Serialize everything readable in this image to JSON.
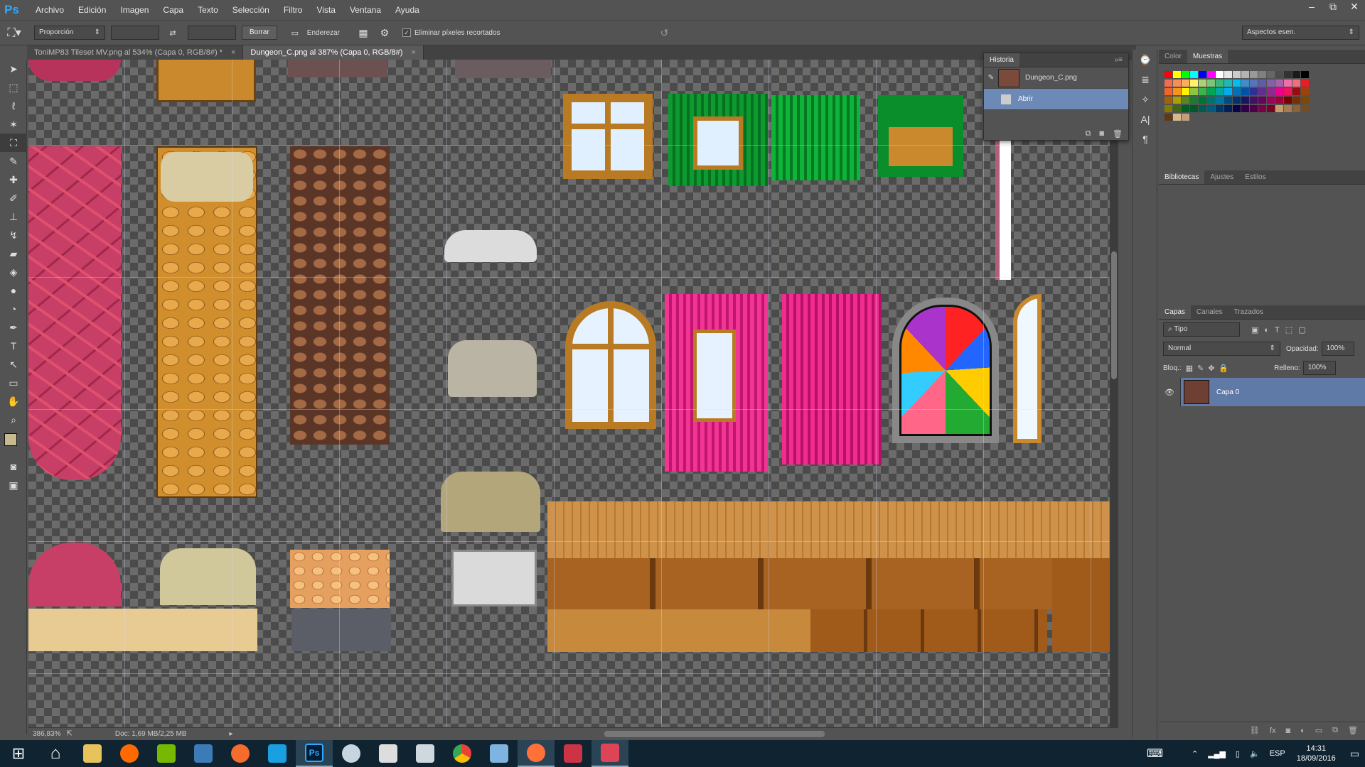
{
  "app": {
    "logo": "Ps"
  },
  "menu": [
    "Archivo",
    "Edición",
    "Imagen",
    "Capa",
    "Texto",
    "Selección",
    "Filtro",
    "Vista",
    "Ventana",
    "Ayuda"
  ],
  "window_controls": [
    "–",
    "⧉",
    "✕"
  ],
  "options": {
    "ratio_select": "Proporción",
    "clear_button": "Borrar",
    "straighten_label": "Enderezar",
    "delete_cropped_label": "Eliminar píxeles recortados",
    "delete_cropped_checked": true,
    "workspace_select": "Aspectos esen."
  },
  "tabs": [
    {
      "label": "ToniMP83 Tileset MV.png al 534% (Capa 0, RGB/8#) *",
      "active": false
    },
    {
      "label": "Dungeon_C.png al 387% (Capa 0, RGB/8#)",
      "active": true
    }
  ],
  "tools": [
    "move-tool",
    "marquee-tool",
    "lasso-tool",
    "magic-wand-tool",
    "crop-tool",
    "eyedropper-tool",
    "healing-tool",
    "brush-tool",
    "stamp-tool",
    "history-brush-tool",
    "eraser-tool",
    "bucket-tool",
    "blur-tool",
    "dodge-tool",
    "pen-tool",
    "type-tool",
    "path-select-tool",
    "shape-tool",
    "hand-tool",
    "zoom-tool"
  ],
  "status": {
    "zoom": "386,83%",
    "doc": "Doc: 1,69 MB/2,25 MB"
  },
  "history_panel": {
    "title": "Historia",
    "snapshot": "Dungeon_C.png",
    "items": [
      "Abrir"
    ]
  },
  "swatches_panel": {
    "tabs": [
      "Color",
      "Muestras"
    ],
    "active": "Muestras",
    "colors": [
      "#ff0000",
      "#ffff00",
      "#00ff00",
      "#00ffff",
      "#0000ff",
      "#ff00ff",
      "#ffffff",
      "#e6e6e6",
      "#cccccc",
      "#b3b3b3",
      "#999999",
      "#808080",
      "#666666",
      "#4d4d4d",
      "#333333",
      "#1a1a1a",
      "#000000",
      "#f26c4f",
      "#f68e56",
      "#fbaf5d",
      "#fff467",
      "#acd372",
      "#7cc576",
      "#3bb878",
      "#1abbb4",
      "#00bff3",
      "#438ccb",
      "#5574b9",
      "#605ca8",
      "#855fa8",
      "#a763a8",
      "#f06ea9",
      "#f26d7d",
      "#ed1c24",
      "#f26522",
      "#f7941d",
      "#fff200",
      "#8dc73f",
      "#39b54a",
      "#00a651",
      "#00a99d",
      "#00aeef",
      "#0072bc",
      "#0054a6",
      "#2e3192",
      "#662d91",
      "#92278f",
      "#ec008c",
      "#ed145b",
      "#9e0b0f",
      "#a0410d",
      "#a36209",
      "#aba000",
      "#598527",
      "#1a7b30",
      "#007236",
      "#00746b",
      "#0076a3",
      "#004b80",
      "#003471",
      "#1b1464",
      "#440e62",
      "#630460",
      "#9e005d",
      "#9e0039",
      "#790000",
      "#7b2e00",
      "#7d4900",
      "#827b00",
      "#406618",
      "#005e20",
      "#005826",
      "#005952",
      "#005b7f",
      "#003663",
      "#002157",
      "#0d004c",
      "#32004b",
      "#4b0049",
      "#7b0046",
      "#7a0026",
      "#c69c6d",
      "#a67c52",
      "#8c6239",
      "#754c24",
      "#603913",
      "#d5b88f",
      "#bfa07a"
    ]
  },
  "libraries_panel": {
    "tabs": [
      "Bibliotecas",
      "Ajustes",
      "Estilos"
    ]
  },
  "layers_panel": {
    "tabs": [
      "Capas",
      "Canales",
      "Trazados"
    ],
    "filter": "Tipo",
    "blend_mode": "Normal",
    "opacity_label": "Opacidad:",
    "opacity": "100%",
    "lock_label": "Bloq.:",
    "fill_label": "Relleno:",
    "fill": "100%",
    "layers": [
      {
        "name": "Capa 0",
        "visible": true
      }
    ]
  },
  "taskbar": {
    "apps": [
      {
        "name": "start",
        "color": "#ffffff"
      },
      {
        "name": "home",
        "color": "#ffffff"
      },
      {
        "name": "explorer",
        "color": "#e8c25a"
      },
      {
        "name": "app-orange-hand",
        "color": "#ff6a00"
      },
      {
        "name": "nvidia",
        "color": "#76b900"
      },
      {
        "name": "app-blue-s",
        "color": "#3d7ab8"
      },
      {
        "name": "origin",
        "color": "#f56c2d"
      },
      {
        "name": "uplay",
        "color": "#1a9fe0"
      },
      {
        "name": "photoshop",
        "color": "#31a8ff"
      },
      {
        "name": "steam",
        "color": "#c7d5e0"
      },
      {
        "name": "film",
        "color": "#dddddd"
      },
      {
        "name": "maps",
        "color": "#cfd8dc"
      },
      {
        "name": "chrome",
        "color": "#4caf50"
      },
      {
        "name": "store",
        "color": "#7fb3e0"
      },
      {
        "name": "firefox",
        "color": "#ff7139"
      },
      {
        "name": "rpgmaker-a",
        "color": "#cc3344"
      },
      {
        "name": "rpgmaker-b",
        "color": "#dd4455"
      }
    ],
    "tray": {
      "lang": "ESP",
      "time": "14:31",
      "date": "18/09/2016"
    }
  }
}
